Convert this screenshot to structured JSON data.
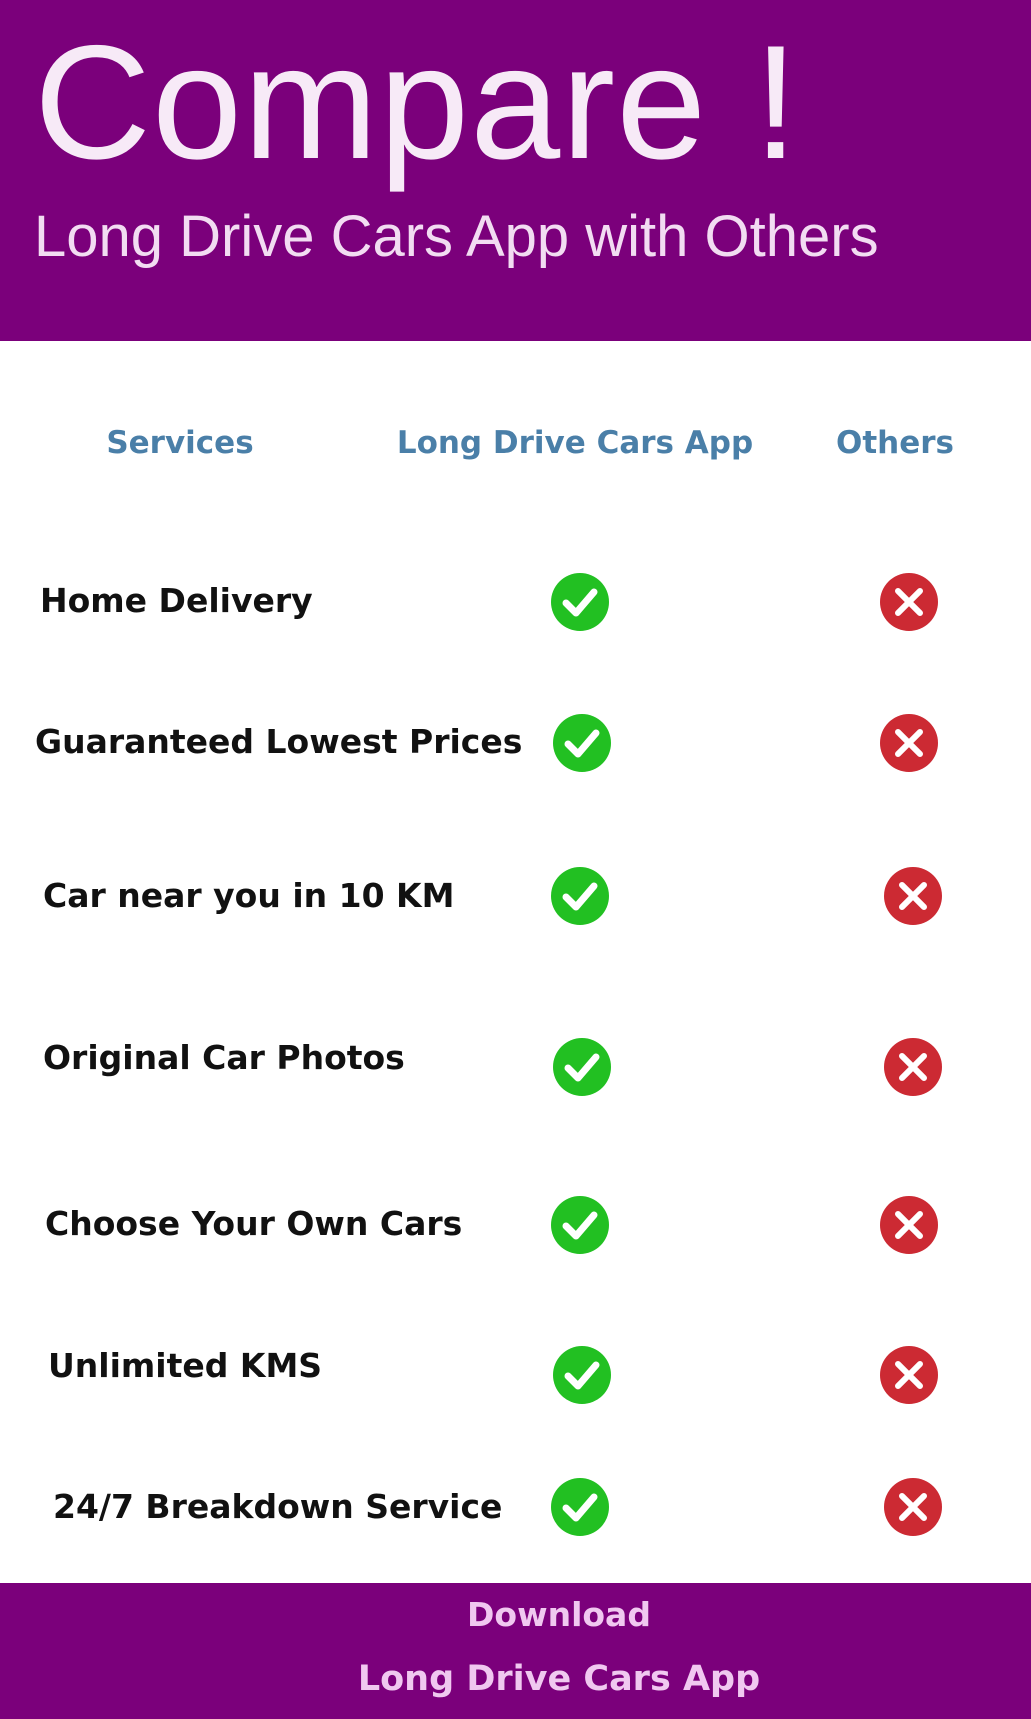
{
  "header": {
    "title": "Compare !",
    "subtitle": "Long Drive Cars App with Others"
  },
  "columns": {
    "services": "Services",
    "app": "Long Drive Cars App",
    "others": "Others"
  },
  "rows": [
    {
      "label": "Home Delivery",
      "app": "check-icon",
      "others": "cross-icon"
    },
    {
      "label": "Guaranteed Lowest Prices",
      "app": "check-icon",
      "others": "cross-icon"
    },
    {
      "label": "Car near you in 10 KM",
      "app": "check-icon",
      "others": "cross-icon"
    },
    {
      "label": "Original Car Photos",
      "app": "check-icon",
      "others": "cross-icon"
    },
    {
      "label": "Choose Your Own Cars",
      "app": "check-icon",
      "others": "cross-icon"
    },
    {
      "label": "Unlimited KMS",
      "app": "check-icon",
      "others": "cross-icon"
    },
    {
      "label": "24/7 Breakdown Service",
      "app": "check-icon",
      "others": "cross-icon"
    }
  ],
  "footer": {
    "line1": "Download",
    "line2": "Long Drive Cars App"
  },
  "colors": {
    "brand_purple": "#7b007b",
    "header_text": "#4a7fa8",
    "check_green": "#22c022",
    "cross_red": "#cc2a33"
  }
}
